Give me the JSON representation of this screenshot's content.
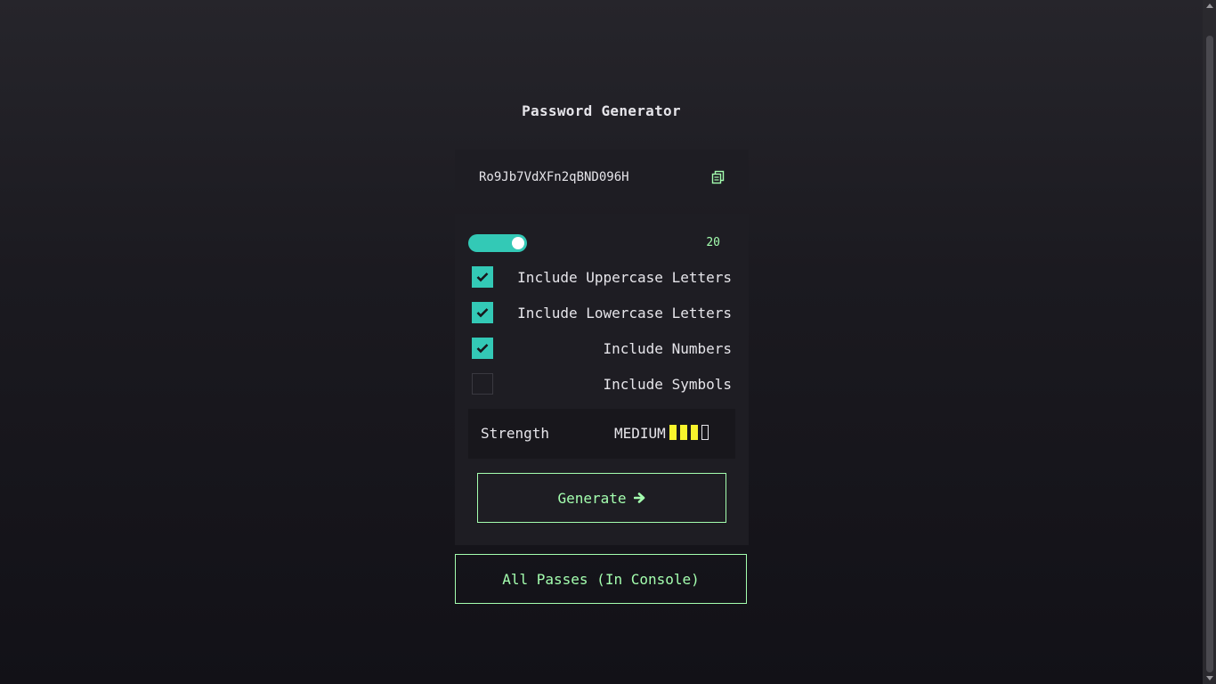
{
  "app": {
    "title": "Password Generator"
  },
  "output": {
    "password": "Ro9Jb7VdXFn2qBND096H",
    "copy_icon": "copy-icon"
  },
  "length": {
    "value": "20"
  },
  "options": [
    {
      "label": "Include Uppercase Letters",
      "checked": true
    },
    {
      "label": "Include Lowercase Letters",
      "checked": true
    },
    {
      "label": "Include Numbers",
      "checked": true
    },
    {
      "label": "Include Symbols",
      "checked": false
    }
  ],
  "strength": {
    "label": "Strength",
    "value": "MEDIUM",
    "level": 3,
    "max": 4
  },
  "buttons": {
    "generate": "Generate",
    "all_passes": "All Passes (In Console)"
  },
  "colors": {
    "accent": "#a4ffaf",
    "teal": "#33c9b6",
    "strength_bar": "#f8f42c"
  }
}
